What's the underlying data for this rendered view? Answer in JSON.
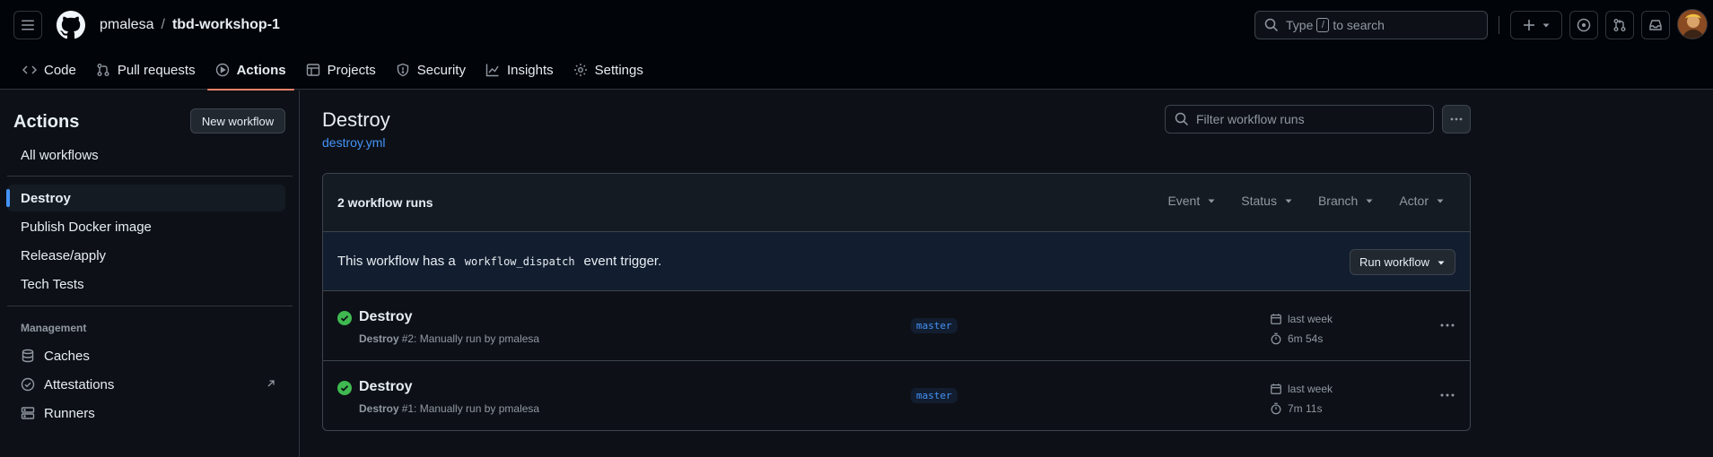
{
  "header": {
    "owner": "pmalesa",
    "separator": "/",
    "repo": "tbd-workshop-1",
    "search_prefix": "Type",
    "search_key": "/",
    "search_suffix": "to search"
  },
  "tabs": [
    {
      "label": "Code",
      "icon": "code-icon"
    },
    {
      "label": "Pull requests",
      "icon": "git-pull-request-icon"
    },
    {
      "label": "Actions",
      "icon": "play-icon",
      "active": true
    },
    {
      "label": "Projects",
      "icon": "table-icon"
    },
    {
      "label": "Security",
      "icon": "shield-icon"
    },
    {
      "label": "Insights",
      "icon": "graph-icon"
    },
    {
      "label": "Settings",
      "icon": "gear-icon"
    }
  ],
  "sidebar": {
    "title": "Actions",
    "new_workflow": "New workflow",
    "all_workflows": "All workflows",
    "workflows": [
      "Destroy",
      "Publish Docker image",
      "Release/apply",
      "Tech Tests"
    ],
    "selected": "Destroy",
    "management_heading": "Management",
    "management": [
      {
        "label": "Caches",
        "icon": "database-icon"
      },
      {
        "label": "Attestations",
        "icon": "verified-icon"
      },
      {
        "label": "Runners",
        "icon": "server-icon"
      }
    ]
  },
  "main": {
    "title": "Destroy",
    "file": "destroy.yml",
    "filter_placeholder": "Filter workflow runs",
    "runs_count": "2 workflow runs",
    "filters": [
      "Event",
      "Status",
      "Branch",
      "Actor"
    ],
    "dispatch": {
      "prefix": "This workflow has a",
      "code": "workflow_dispatch",
      "suffix": "event trigger.",
      "button": "Run workflow"
    },
    "runs": [
      {
        "title": "Destroy",
        "workflow": "Destroy",
        "detail": "#2: Manually run by pmalesa",
        "branch": "master",
        "when": "last week",
        "duration": "6m 54s",
        "status": "success"
      },
      {
        "title": "Destroy",
        "workflow": "Destroy",
        "detail": "#1: Manually run by pmalesa",
        "branch": "master",
        "when": "last week",
        "duration": "7m 11s",
        "status": "success"
      }
    ]
  },
  "colors": {
    "accent": "#4493f8",
    "success": "#3fb950",
    "tab_underline": "#f78166",
    "background": "#0d1117"
  }
}
